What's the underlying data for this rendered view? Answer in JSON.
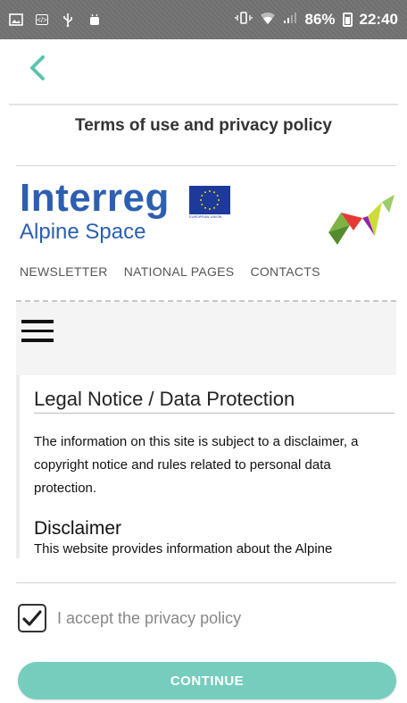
{
  "status_bar": {
    "battery": "86%",
    "time": "22:40",
    "icons": [
      "image-icon",
      "code-icon",
      "usb-icon",
      "android-icon",
      "vibrate-icon",
      "wifi-icon",
      "signal-icon",
      "battery-icon"
    ]
  },
  "header": {
    "title": "Terms of use and privacy policy",
    "back_icon": "chevron-left-icon"
  },
  "webview": {
    "brand_name": "Interreg",
    "brand_sub": "Alpine Space",
    "eu_label": "EUROPEAN UNION",
    "nav_links": [
      "NEWSLETTER",
      "NATIONAL PAGES",
      "CONTACTS"
    ],
    "menu_icon": "hamburger-icon",
    "legal_heading": "Legal Notice / Data Protection",
    "legal_text": "The information on this site is subject to a disclaimer, a copyright notice and rules related to personal data protection.",
    "disclaimer_heading": "Disclaimer",
    "disclaimer_text": "This website provides information about the Alpine"
  },
  "consent": {
    "checked": true,
    "label": "I accept the privacy policy"
  },
  "actions": {
    "continue_label": "CONTINUE"
  },
  "colors": {
    "accent": "#5cc2b0",
    "button": "#76cdbd",
    "brand_blue": "#2d5fb0"
  }
}
